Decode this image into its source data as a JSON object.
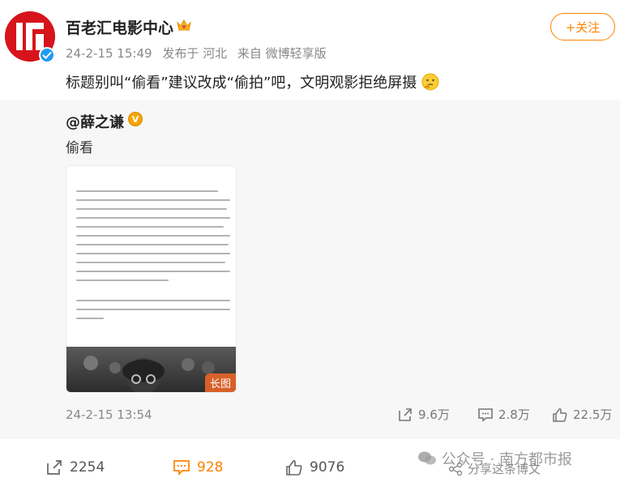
{
  "post": {
    "username": "百老汇电影中心",
    "date": "24-2-15 15:49",
    "location": "发布于 河北",
    "source": "来自 微博轻享版",
    "follow_label": "+关注",
    "text": "标题别叫“偷看”建议改成“偷拍”吧，文明观影拒绝屏摄"
  },
  "repost": {
    "author": "@薛之谦",
    "text": "偷看",
    "long_image_tag": "长图",
    "date": "24-2-15 13:54",
    "shares": "9.6万",
    "comments": "2.8万",
    "likes": "22.5万"
  },
  "bottom_bar": {
    "shares": "2254",
    "comments": "928",
    "likes": "9076"
  },
  "watermark": {
    "text": "公众号 · 南方都市报",
    "share_text": "分享这条博文"
  },
  "colors": {
    "accent": "#ff8200",
    "verify_blue": "#1e9bf0",
    "avatar_red": "#d7141b",
    "repost_bg": "#f7f7f7"
  }
}
